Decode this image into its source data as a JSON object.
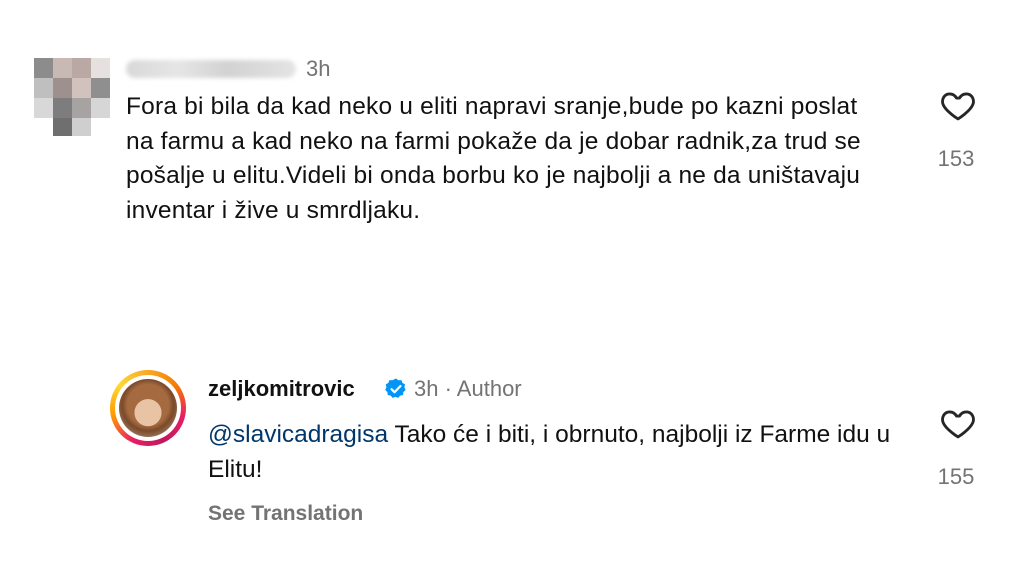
{
  "comment1": {
    "time": "3h",
    "text": "Fora bi bila da kad neko u eliti napravi sranje,bude po kazni poslat na farmu a kad neko na farmi pokaže da je dobar radnik,za trud se pošalje u elitu.Videli bi onda borbu ko je najbolji a ne da uništavaju inventar i žive u smrdljaku.",
    "like_count": "153",
    "like_icon": "heart-outline-icon"
  },
  "comment2": {
    "username": "zeljkomitrovic",
    "verified_icon": "verified-badge-icon",
    "meta": "3h · Author",
    "mention": "@slavicadragisa",
    "text": " Tako će i biti, i obrnuto, najbolji iz Farme idu u Elitu!",
    "like_count": "155",
    "like_icon": "heart-outline-icon",
    "see_translation": "See Translation"
  },
  "colors": {
    "secondary_text": "#737373",
    "mention": "#00376b",
    "verified": "#0095f6"
  }
}
